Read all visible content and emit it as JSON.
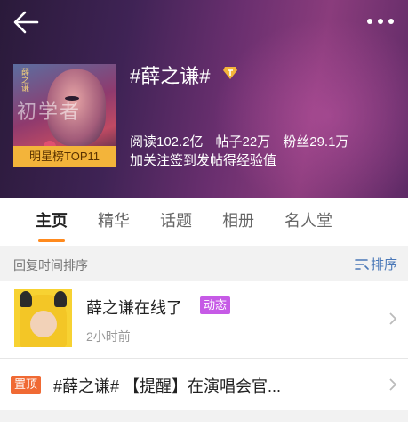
{
  "header": {
    "back_icon": "arrow-left-icon",
    "more_icon": "more-dots-icon",
    "title": "#薛之谦#",
    "verified_icon": "super-topic-badge-icon",
    "cover": {
      "overlay_text": "初学者",
      "rank_label": "明星榜TOP11"
    },
    "stats": [
      {
        "label": "阅读102.2亿"
      },
      {
        "label": "帖子22万"
      },
      {
        "label": "粉丝29.1万"
      }
    ],
    "hint": "加关注签到发帖得经验值"
  },
  "tabs": [
    {
      "label": "主页",
      "active": true
    },
    {
      "label": "精华"
    },
    {
      "label": "话题"
    },
    {
      "label": "相册"
    },
    {
      "label": "名人堂"
    }
  ],
  "sort_bar": {
    "label": "回复时间排序",
    "sort_button": "排序",
    "sort_icon": "sort-lines-icon"
  },
  "posts": [
    {
      "title": "薛之谦在线了",
      "tag": "动态",
      "time": "2小时前",
      "avatar_icon": "avatar-pikachu-costume"
    }
  ],
  "pinned": {
    "badge": "置顶",
    "text": "#薛之谦# 【提醒】在演唱会官..."
  },
  "colors": {
    "accent_orange": "#ff8a1e",
    "tag_purple": "#c65ae6",
    "pin_orange": "#f06a34",
    "link_blue": "#4a78b8",
    "rank_gold": "#f3b43a"
  }
}
